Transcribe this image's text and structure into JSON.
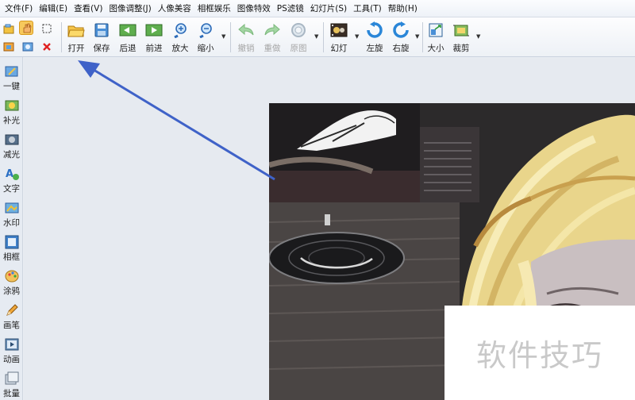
{
  "menu": [
    "文件(F)",
    "编辑(E)",
    "查看(V)",
    "图像调整(J)",
    "人像美容",
    "相框娱乐",
    "图像特效",
    "PS滤镜",
    "幻灯片(S)",
    "工具(T)",
    "帮助(H)"
  ],
  "toolbar": {
    "open": "打开",
    "save": "保存",
    "back": "后退",
    "forward": "前进",
    "zoom_in": "放大",
    "zoom_out": "缩小",
    "undo": "撤销",
    "redo": "重做",
    "original": "原图",
    "slideshow": "幻灯",
    "rotate_left": "左旋",
    "rotate_right": "右旋",
    "size": "大小",
    "crop": "裁剪"
  },
  "sidebar": [
    "一键",
    "补光",
    "减光",
    "文字",
    "水印",
    "相框",
    "涂鸦",
    "画笔",
    "动画",
    "批量"
  ],
  "watermark_text": "软件技巧",
  "accent_color": "#3f62c8"
}
